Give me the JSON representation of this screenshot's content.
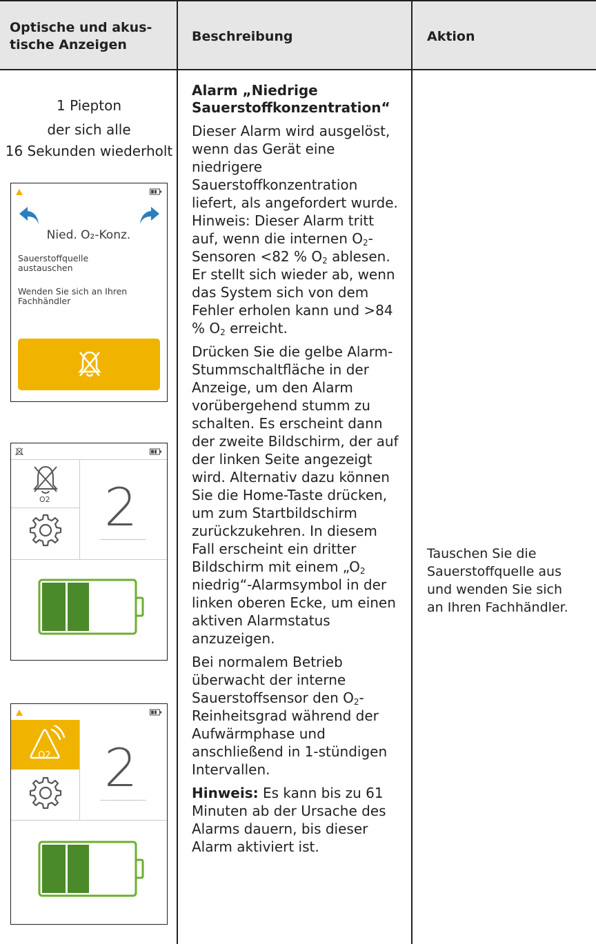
{
  "header": {
    "col1": "Optische und akus-\ntische Anzeigen",
    "col2": "Beschreibung",
    "col3": "Aktion"
  },
  "indicator": {
    "line1": "1 Piepton",
    "line2": "der sich alle",
    "line3": "16 Sekunden wiederholt"
  },
  "screen1": {
    "title": "Nied. O₂-Konz.",
    "instruction1": "Sauerstoffquelle\naustauschen",
    "instruction2": "Wenden Sie sich an Ihren\nFachhändler"
  },
  "screen2": {
    "o2_label": "O2",
    "value": "2"
  },
  "screen3": {
    "badge_label": "O2",
    "value": "2"
  },
  "description": {
    "title": "Alarm „Niedrige Sauerstoffkonzentration“",
    "p1_a": "Dieser Alarm wird ausgelöst, wenn das Gerät eine niedrigere Sauerstoffkonzentration liefert, als angefordert wurde. Hinweis: Dieser Alarm tritt auf, wenn die internen O",
    "p1_b": "-Sensoren <82 % O",
    "p1_c": " ablesen. Er stellt sich wieder ab, wenn das System sich von dem Fehler erholen kann und >84 % O",
    "p1_d": " erreicht.",
    "sub": "2",
    "p2_a": "Drücken Sie die gelbe Alarm-Stummschaltfläche in der Anzeige, um den Alarm vorübergehend stumm zu schalten. Es erscheint dann der zweite Bildschirm, der auf der linken Seite angezeigt wird. Alternativ dazu können Sie die Home-Taste drücken, um zum Startbildschirm zurückzukehren. In diesem Fall erscheint ein dritter Bildschirm mit einem „O",
    "p2_b": " niedrig“-Alarmsymbol in der linken oberen Ecke, um einen aktiven Alarmstatus anzuzeigen.",
    "p3_a": "Bei normalem Betrieb überwacht der interne Sauerstoffsensor den O",
    "p3_b": "-Reinheitsgrad während der Aufwärmphase und anschließend in 1-stündigen Intervallen.",
    "p4_bold": "Hinweis:",
    "p4_rest": " Es kann bis zu 61 Minuten ab der Ursache des Alarms dauern, bis dieser Alarm aktiviert ist."
  },
  "action": {
    "text": "Tauschen Sie die Sauerstoffquelle aus und wenden Sie sich an Ihren Fachhändler."
  },
  "colors": {
    "header_bg": "#e6e6e6",
    "alarm_yellow": "#f0b400",
    "arrow_blue": "#2a7fc1",
    "battery_green": "#4a8a2a",
    "battery_outline": "#6cae2f"
  }
}
